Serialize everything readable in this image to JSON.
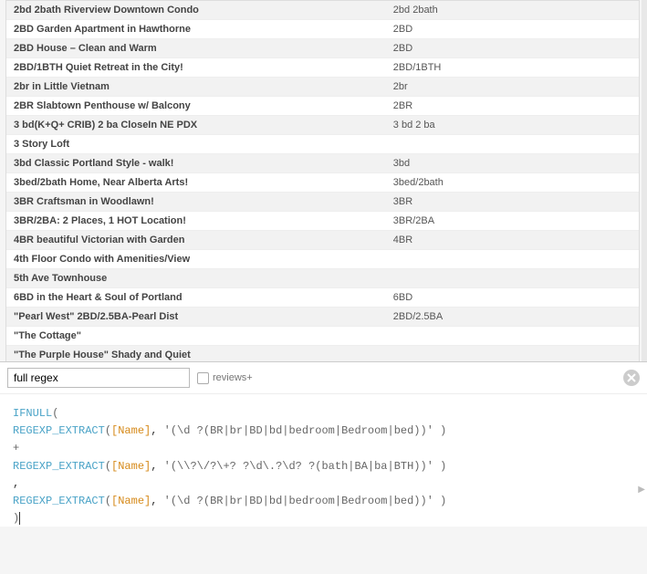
{
  "table": {
    "rows": [
      {
        "name": "2bd 2bath Riverview Downtown Condo",
        "extract": "2bd 2bath"
      },
      {
        "name": "2BD Garden Apartment in Hawthorne",
        "extract": "2BD"
      },
      {
        "name": "2BD House – Clean and Warm",
        "extract": "2BD"
      },
      {
        "name": "2BD/1BTH Quiet Retreat in the City!",
        "extract": "2BD/1BTH"
      },
      {
        "name": "2br in Little Vietnam",
        "extract": "2br"
      },
      {
        "name": "2BR Slabtown Penthouse w/ Balcony",
        "extract": "2BR"
      },
      {
        "name": "3 bd(K+Q+ CRIB) 2 ba CloseIn NE PDX",
        "extract": "3 bd 2 ba"
      },
      {
        "name": "3 Story Loft",
        "extract": ""
      },
      {
        "name": "3bd Classic Portland Style - walk!",
        "extract": "3bd"
      },
      {
        "name": "3bed/2bath Home, Near Alberta Arts!",
        "extract": "3bed/2bath"
      },
      {
        "name": "3BR Craftsman in Woodlawn!",
        "extract": "3BR"
      },
      {
        "name": "3BR/2BA: 2 Places, 1 HOT Location!",
        "extract": "3BR/2BA"
      },
      {
        "name": "4BR beautiful Victorian with Garden",
        "extract": "4BR"
      },
      {
        "name": "4th Floor Condo with Amenities/View",
        "extract": ""
      },
      {
        "name": "5th Ave Townhouse",
        "extract": ""
      },
      {
        "name": "6BD in the Heart & Soul of Portland",
        "extract": "6BD"
      },
      {
        "name": "\"Pearl West\"  2BD/2.5BA-Pearl Dist",
        "extract": "2BD/2.5BA"
      },
      {
        "name": "\"The Cottage\"",
        "extract": ""
      },
      {
        "name": "\"The Purple House\" Shady and Quiet",
        "extract": ""
      }
    ]
  },
  "editor": {
    "field_name": "full regex",
    "checkbox_label": "reviews+",
    "code": {
      "l1_kw": "IFNULL",
      "l1_open": "(",
      "l2_fn": "REGEXP_EXTRACT",
      "l2_open": "(",
      "l2_field": "[Name]",
      "l2_sep": ", ",
      "l2_str": "'(\\d ?(BR|br|BD|bd|bedroom|Bedroom|bed))'",
      "l2_close": " )",
      "l3_plus": "+",
      "l4_fn": "REGEXP_EXTRACT",
      "l4_open": "(",
      "l4_field": "[Name]",
      "l4_sep": ", ",
      "l4_str": "'(\\\\?\\/?\\+? ?\\d\\.?\\d? ?(bath|BA|ba|BTH))'",
      "l4_close": " )",
      "l5_comma": ",",
      "l6_fn": "REGEXP_EXTRACT",
      "l6_open": "(",
      "l6_field": "[Name]",
      "l6_sep": ", ",
      "l6_str": "'(\\d ?(BR|br|BD|bd|bedroom|Bedroom|bed))'",
      "l6_close": " )",
      "l7_close": ")"
    }
  }
}
